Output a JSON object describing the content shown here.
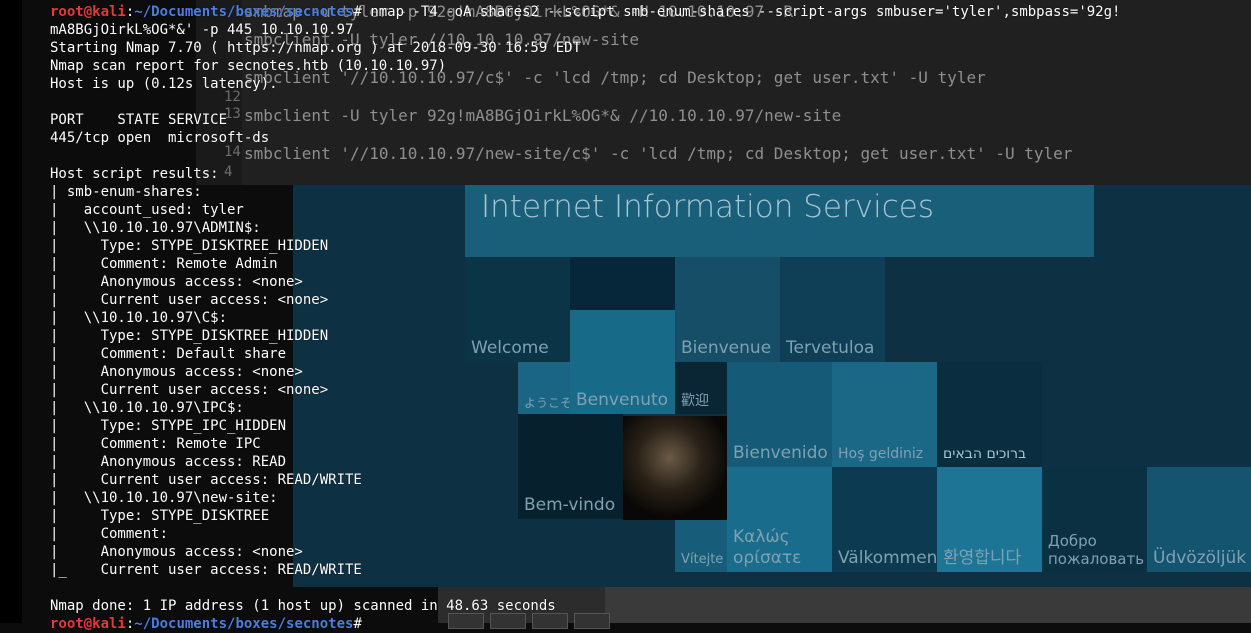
{
  "editor": {
    "lines": [
      {
        "number": "",
        "text": "smbmap -u tyler -p 92g!mA8BGjOirkL%OG*& -H 10.10.10.97 -R"
      },
      {
        "number": "",
        "text": "smbclient -U tyler //10.10.10.97/new-site"
      },
      {
        "number": "",
        "text": "smbclient '//10.10.10.97/c$' -c 'lcd /tmp; cd Desktop; get user.txt' -U tyler"
      },
      {
        "number": "12",
        "text": ""
      },
      {
        "number": "13",
        "text": "smbclient -U tyler 92g!mA8BGjOirkL%OG*& //10.10.10.97/new-site"
      },
      {
        "number": "",
        "text": ""
      },
      {
        "number": "14",
        "text": "smbclient '//10.10.10.97/new-site/c$' -c 'lcd /tmp; cd Desktop; get user.txt' -U tyler"
      },
      {
        "number": "4",
        "text": ""
      }
    ]
  },
  "iis": {
    "title": "Internet Information Services",
    "tiles": {
      "welcome": "Welcome",
      "bienvenue": "Bienvenue",
      "tervetuloa": "Tervetuloa",
      "youkoso": "ようこそ",
      "benvenuto": "Benvenuto",
      "huanying": "歡迎",
      "bienvenido": "Bienvenido",
      "hosgeldiniz": "Hoş geldiniz",
      "hebrew": "ברוכים הבאים",
      "bemvindo": "Bem-vindo",
      "vitejte": "Vítejte",
      "kalos": "Καλώς ορίσατε",
      "valkommen": "Välkommen",
      "korean": "환영합니다",
      "dobro": "Добро пожаловать",
      "udvozoljuk": "Üdvözöljük"
    }
  },
  "terminal": {
    "prompt_user": "root@kali",
    "prompt_sep": ":",
    "prompt_path": "~/Documents/boxes/secnotes",
    "prompt_symbol": "# ",
    "command": "nmap -T4 -oA shares2 --script smb-enum-shares --script-args smbuser='tyler',smbpass='92g!",
    "output": [
      "mA8BGjOirkL%OG*&' -p 445 10.10.10.97",
      "Starting Nmap 7.70 ( https://nmap.org ) at 2018-09-30 16:59 EDT",
      "Nmap scan report for secnotes.htb (10.10.10.97)",
      "Host is up (0.12s latency).",
      "",
      "PORT    STATE SERVICE",
      "445/tcp open  microsoft-ds",
      "",
      "Host script results:",
      "| smb-enum-shares:",
      "|   account_used: tyler",
      "|   \\\\10.10.10.97\\ADMIN$:",
      "|     Type: STYPE_DISKTREE_HIDDEN",
      "|     Comment: Remote Admin",
      "|     Anonymous access: <none>",
      "|     Current user access: <none>",
      "|   \\\\10.10.10.97\\C$:",
      "|     Type: STYPE_DISKTREE_HIDDEN",
      "|     Comment: Default share",
      "|     Anonymous access: <none>",
      "|     Current user access: <none>",
      "|   \\\\10.10.10.97\\IPC$:",
      "|     Type: STYPE_IPC_HIDDEN",
      "|     Comment: Remote IPC",
      "|     Anonymous access: READ",
      "|     Current user access: READ/WRITE",
      "|   \\\\10.10.10.97\\new-site:",
      "|     Type: STYPE_DISKTREE",
      "|     Comment:",
      "|     Anonymous access: <none>",
      "|_    Current user access: READ/WRITE",
      "",
      "Nmap done: 1 IP address (1 host up) scanned in 48.63 seconds"
    ]
  }
}
